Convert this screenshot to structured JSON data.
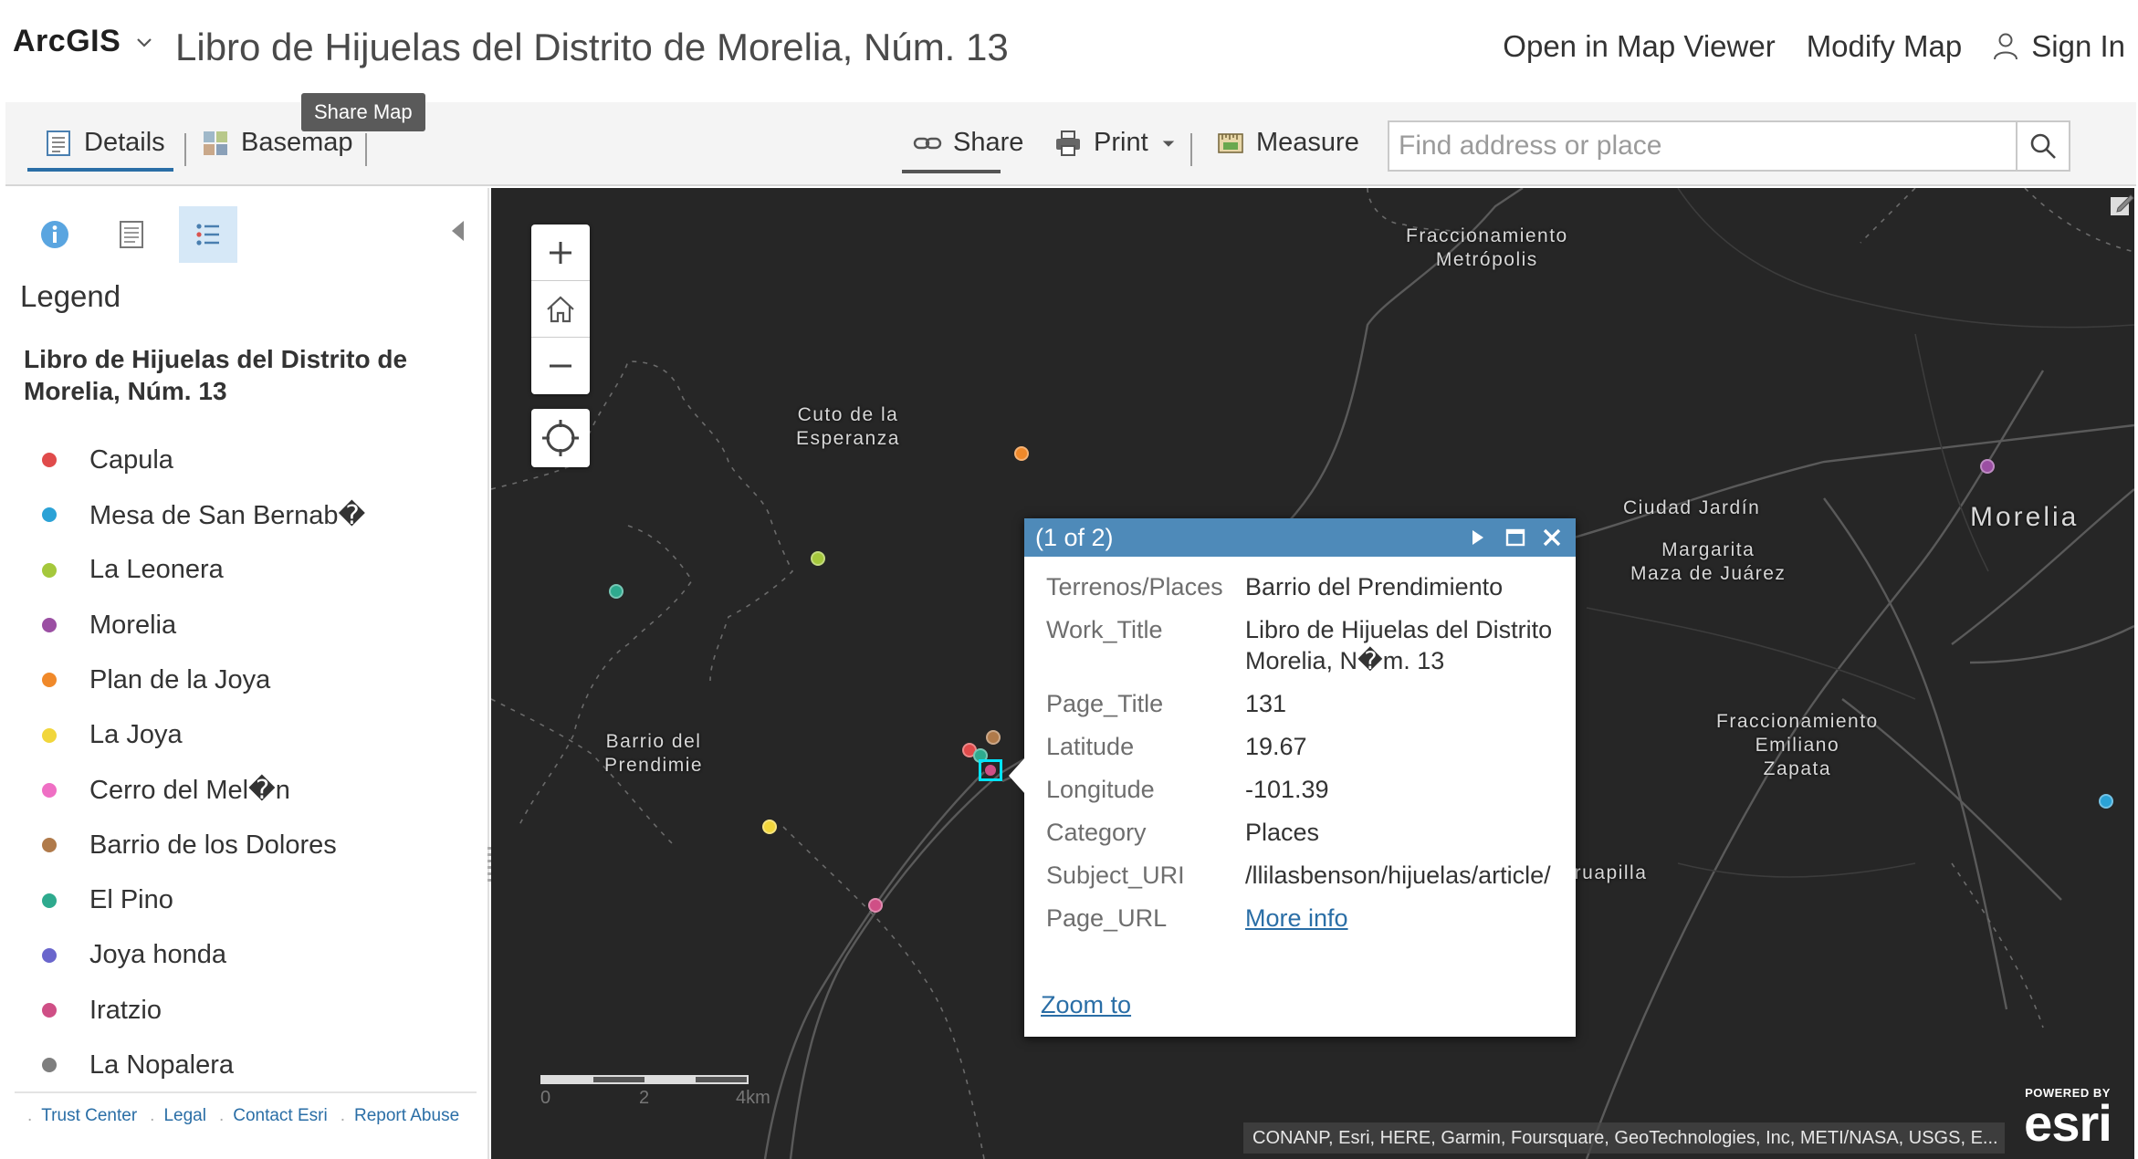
{
  "header": {
    "brand": "ArcGIS",
    "title": "Libro de Hijuelas del Distrito de Morelia, Núm. 13",
    "links": {
      "open_map_viewer": "Open in Map Viewer",
      "modify_map": "Modify Map",
      "sign_in": "Sign In"
    }
  },
  "toolbar": {
    "details": "Details",
    "basemap": "Basemap",
    "tooltip": "Share Map",
    "share": "Share",
    "print": "Print",
    "measure": "Measure",
    "search_placeholder": "Find address or place"
  },
  "panel": {
    "legend_heading": "Legend",
    "layer_title": "Libro de Hijuelas del Distrito de Morelia, Núm. 13",
    "legend": [
      {
        "label": "Capula",
        "color": "#e04b4b"
      },
      {
        "label": "Mesa de San Bernab�",
        "color": "#2ba2d6"
      },
      {
        "label": "La Leonera",
        "color": "#a5c83c"
      },
      {
        "label": "Morelia",
        "color": "#9b4fa3"
      },
      {
        "label": "Plan de la Joya",
        "color": "#f0892a"
      },
      {
        "label": "La Joya",
        "color": "#f1d63c"
      },
      {
        "label": "Cerro del Mel�n",
        "color": "#ef6fc4"
      },
      {
        "label": "Barrio de los Dolores",
        "color": "#b07a4a"
      },
      {
        "label": "El Pino",
        "color": "#2eaa8e"
      },
      {
        "label": "Joya honda",
        "color": "#6a66cc"
      },
      {
        "label": "Iratzio",
        "color": "#cf4f86"
      },
      {
        "label": "La Nopalera",
        "color": "#7e7e7e"
      }
    ],
    "footer": {
      "trust_center": "Trust Center",
      "legal": "Legal",
      "contact": "Contact Esri",
      "report_abuse": "Report Abuse"
    }
  },
  "map": {
    "labels": {
      "fracc_metropolis": "Fraccionamiento\nMetrópolis",
      "cuto": "Cuto de la\nEsperanza",
      "ciudad_jardin": "Ciudad Jardín",
      "morelia": "Morelia",
      "margarita": "Margarita\nMaza de Juárez",
      "barrio": "Barrio del\nPrendimie",
      "fracc_emiliano": "Fraccionamiento\nEmiliano\nZapata",
      "uruapilla": "Uruapilla"
    },
    "scale": {
      "t0": "0",
      "t1": "2",
      "t2": "4km"
    },
    "attribution": "CONANP, Esri, HERE, Garmin, Foursquare, GeoTechnologies, Inc, METI/NASA, USGS, E...",
    "esri": {
      "powered": "POWERED BY",
      "word": "esri"
    }
  },
  "popup": {
    "count": "(1 of 2)",
    "fields": [
      {
        "label": "Terrenos/Places",
        "value": "Barrio del Prendimiento"
      },
      {
        "label": "Work_Title",
        "value": "Libro de Hijuelas del Distrito\nMorelia, N�m. 13"
      },
      {
        "label": "Page_Title",
        "value": "131"
      },
      {
        "label": "Latitude",
        "value": "19.67"
      },
      {
        "label": "Longitude",
        "value": "-101.39"
      },
      {
        "label": "Category",
        "value": "Places"
      },
      {
        "label": "Subject_URI",
        "value": "/llilasbenson/hijuelas/article/"
      }
    ],
    "page_url_label": "Page_URL",
    "page_url_link": "More info",
    "zoom_to": "Zoom to"
  }
}
